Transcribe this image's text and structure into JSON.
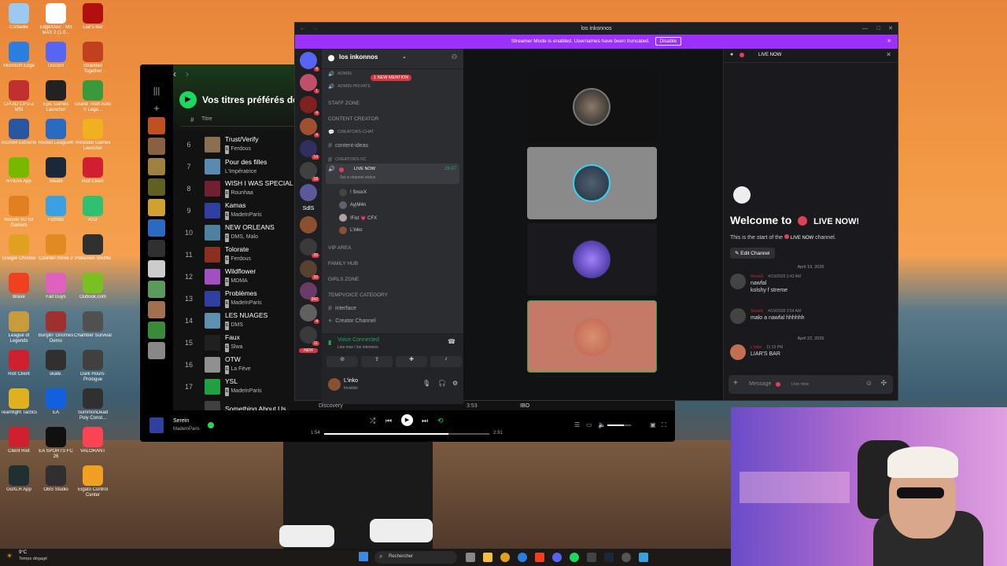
{
  "desktop": {
    "icons": [
      {
        "label": "Corbeille",
        "color": "#9cc9f0"
      },
      {
        "label": "Edge/Disc - M3 MAX 2 (1.0...",
        "color": "#ffffff"
      },
      {
        "label": "Liar's Bar",
        "color": "#b01010"
      },
      {
        "label": "Microsoft Edge",
        "color": "#2a7de1"
      },
      {
        "label": "Discord",
        "color": "#5865f2"
      },
      {
        "label": "Stranded Together",
        "color": "#c04020"
      },
      {
        "label": "CPUID CPU-Z MSI",
        "color": "#c03030"
      },
      {
        "label": "Epic Games Launcher",
        "color": "#222222"
      },
      {
        "label": "Grand Theft Auto V Lega...",
        "color": "#3a9a3a"
      },
      {
        "label": "AIDA64 Extreme",
        "color": "#2a55a0"
      },
      {
        "label": "Rocket League®",
        "color": "#2a6ac0"
      },
      {
        "label": "Rockstar Games Launcher",
        "color": "#f0b020"
      },
      {
        "label": "NVIDIA App",
        "color": "#76b900"
      },
      {
        "label": "Steam",
        "color": "#1b2838"
      },
      {
        "label": "Riot Client",
        "color": "#d02030"
      },
      {
        "label": "Nouvel SD for Gamers",
        "color": "#e08020"
      },
      {
        "label": "Fortnite",
        "color": "#3aa0e0"
      },
      {
        "label": "Azur",
        "color": "#30c070"
      },
      {
        "label": "Google Chrome",
        "color": "#e0a020"
      },
      {
        "label": "Counter-Strike 2",
        "color": "#e08a20"
      },
      {
        "label": "Pokemon Shuffle",
        "color": "#303030"
      },
      {
        "label": "Brave",
        "color": "#f04020"
      },
      {
        "label": "Fall Guys",
        "color": "#e060c0"
      },
      {
        "label": "Outlook.com",
        "color": "#7ac020"
      },
      {
        "label": "League of Legends",
        "color": "#c89b3c"
      },
      {
        "label": "Burglin' Gnomes Demo",
        "color": "#a03030"
      },
      {
        "label": "Chamber Survival",
        "color": "#505050"
      },
      {
        "label": "Riot Client",
        "color": "#d02030"
      },
      {
        "label": "skate.",
        "color": "#303030"
      },
      {
        "label": "Dark Hours: Prologue",
        "color": "#404040"
      },
      {
        "label": "Teamfight Tactics",
        "color": "#e0b020"
      },
      {
        "label": "EA",
        "color": "#1060e0"
      },
      {
        "label": "SummonDead Poly Const...",
        "color": "#303030"
      },
      {
        "label": "Client Riot",
        "color": "#d02030"
      },
      {
        "label": "EA SPORTS FC 26",
        "color": "#101010"
      },
      {
        "label": "VALORANT",
        "color": "#fa4454"
      },
      {
        "label": "GoXLR App",
        "color": "#203030"
      },
      {
        "label": "OBS Studio",
        "color": "#302e31"
      },
      {
        "label": "Elgato Control Center",
        "color": "#f0a020"
      }
    ]
  },
  "spotify": {
    "playlist_title": "Vos titres préférés de",
    "col_title": "Titre",
    "rows": [
      {
        "n": "6",
        "title": "Trust/Verify",
        "artist": "Ferdous",
        "explicit": true,
        "art": "#8a7050"
      },
      {
        "n": "7",
        "title": "Pour des filles",
        "artist": "L'Impératrice",
        "explicit": false,
        "art": "#5a8ab0"
      },
      {
        "n": "8",
        "title": "WISH I WAS SPECIAL",
        "artist": "Rounhaa",
        "explicit": true,
        "art": "#702030"
      },
      {
        "n": "9",
        "title": "Kamas",
        "artist": "MadeInParis",
        "explicit": true,
        "art": "#3040a0"
      },
      {
        "n": "10",
        "title": "NEW ORLEANS",
        "artist": "DMS, Malo",
        "explicit": true,
        "art": "#5080a0"
      },
      {
        "n": "11",
        "title": "Tolorate",
        "artist": "Ferdous",
        "explicit": true,
        "art": "#8a3020"
      },
      {
        "n": "12",
        "title": "Wildflower",
        "artist": "MDMA",
        "explicit": true,
        "art": "#a050c0"
      },
      {
        "n": "13",
        "title": "Problèmes",
        "artist": "MadeInParis",
        "explicit": true,
        "art": "#3040a0"
      },
      {
        "n": "14",
        "title": "LES NUAGES",
        "artist": "DMS",
        "explicit": true,
        "art": "#6090b0"
      },
      {
        "n": "15",
        "title": "Faux",
        "artist": "Slwa",
        "explicit": true,
        "art": "#202020"
      },
      {
        "n": "16",
        "title": "OTW",
        "artist": "La Fève",
        "explicit": true,
        "art": "#909090"
      },
      {
        "n": "17",
        "title": "YSL",
        "artist": "MadeInParis",
        "explicit": true,
        "art": "#20a040"
      },
      {
        "n": "",
        "title": "Something About Us",
        "artist": "",
        "explicit": false,
        "art": "#404040"
      }
    ],
    "now_playing": {
      "title": "Serein",
      "artist": "MadeInParis"
    },
    "time_elapsed": "1:54",
    "time_total": "2:31",
    "progress": 0.75,
    "volume": 0.7
  },
  "discord": {
    "window_title": "los inkonnos",
    "banner_text": "Streamer Mode is enabled. Usernames have been truncated.",
    "banner_button": "Disable",
    "server_name": "los inkonnos",
    "mention_badge": "1 NEW MENTION",
    "server_label": "SdlS",
    "new_badge": "NEW",
    "server_badges": [
      "4",
      "1",
      "4",
      "4",
      "14",
      "18",
      "",
      "",
      "20",
      "20",
      "342",
      "4",
      "11"
    ],
    "channels": {
      "admin": "ADMIN",
      "admin_private": "ADMIN PRIVATE",
      "staff_zone": "STAFF ZONE",
      "content_creator": "CONTENT CREATOR",
      "creators_chat": "CREATORS-CHAT",
      "content_ideas": "content-ideas",
      "creators_vc": "CREATORS-VC",
      "live_now": "LIVE NOW",
      "live_time": "26:47",
      "set_status": "Set a channel status",
      "members": [
        "! SnoxX",
        "Ay|M4n",
        "!Fist 💗 CFX",
        "L'inko"
      ],
      "vip_area": "VIP AREA",
      "family_hub": "FAMILY HUB",
      "girls_zone": "GIRLS ZONE",
      "tempvoice": "TEMPVOICE CATEGORY",
      "interface": "interface",
      "creator_channel": "Creator Channel"
    },
    "voice_connected": "Voice Connected",
    "voice_sub": "Live now / los inkonnos",
    "user_name": "L'inko",
    "user_status": "Invisible",
    "chat_header": "LIVE NOW",
    "welcome_title": "Welcome to",
    "welcome_channel": "LIVE NOW!",
    "welcome_sub_pre": "This is the start of the",
    "welcome_sub_channel": "LIVE NOW",
    "welcome_sub_post": "channel.",
    "edit_channel": "Edit Channel",
    "date1": "April 19, 2026",
    "date2": "April 22, 2026",
    "messages": [
      {
        "user": "SnoxX",
        "time": "4/19/2026 3:43 AM",
        "lines": [
          "nawfal",
          "kolshy f streme"
        ]
      },
      {
        "user": "SnoxX",
        "time": "4/19/2026 3:54 AM",
        "lines": [
          "malo a nawfal hhhhhh"
        ]
      },
      {
        "user": "L'inko",
        "time": "11:13 PM",
        "lines": [
          "LIAR'S BAR"
        ]
      }
    ],
    "message_placeholder": "Message",
    "message_channel": "Live now",
    "spotify_peek": {
      "left": "Discovery",
      "mid": "3:53",
      "right": "IBO"
    }
  },
  "taskbar": {
    "weather_temp": "9°C",
    "weather_desc": "Temps dégagé",
    "search_placeholder": "Rechercher"
  }
}
